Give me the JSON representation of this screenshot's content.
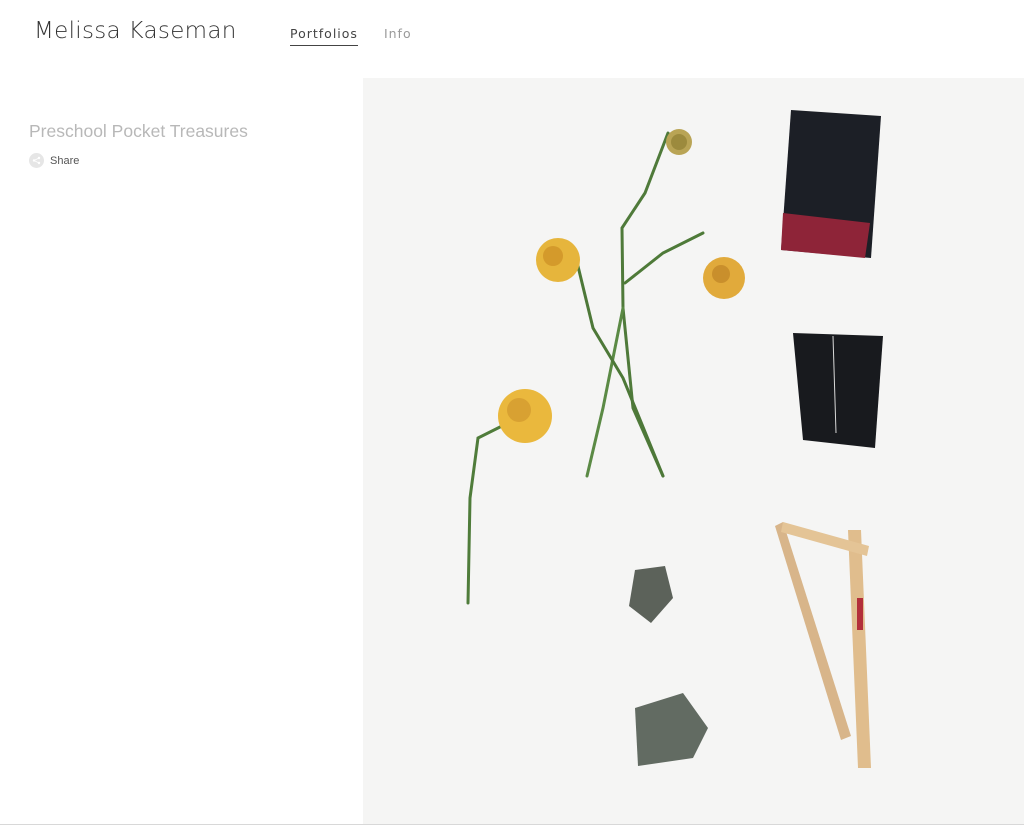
{
  "site": {
    "title": "Melissa Kaseman"
  },
  "nav": {
    "items": [
      {
        "label": "Portfolios",
        "active": true
      },
      {
        "label": "Info",
        "active": false
      }
    ]
  },
  "project": {
    "title": "Preschool Pocket Treasures",
    "share_label": "Share"
  },
  "colors": {
    "background": "#ffffff",
    "title_text": "#333333",
    "project_title_text": "#b8b8b8",
    "nav_inactive": "#9a9a9a",
    "nav_active": "#444444",
    "photo_background": "#f4f4f3"
  },
  "icons": {
    "share": "share-icon"
  }
}
